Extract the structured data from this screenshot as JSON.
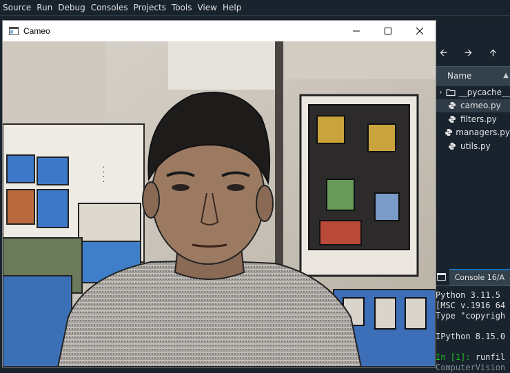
{
  "menubar": {
    "items": [
      "Source",
      "Run",
      "Debug",
      "Consoles",
      "Projects",
      "Tools",
      "View",
      "Help"
    ]
  },
  "cameo": {
    "title": "Cameo",
    "icons": {
      "minimize": "minimize-icon",
      "maximize": "maximize-icon",
      "close": "close-icon"
    }
  },
  "explorer": {
    "nav_icons": [
      "arrow-left-icon",
      "arrow-right-icon",
      "arrow-up-icon"
    ],
    "header": "Name",
    "items": [
      {
        "label": "__pycache__",
        "type": "folder",
        "expandable": true,
        "selected": false
      },
      {
        "label": "cameo.py",
        "type": "python-file",
        "expandable": false,
        "selected": true
      },
      {
        "label": "filters.py",
        "type": "python-file",
        "expandable": false,
        "selected": false
      },
      {
        "label": "managers.py",
        "type": "python-file",
        "expandable": false,
        "selected": false
      },
      {
        "label": "utils.py",
        "type": "python-file",
        "expandable": false,
        "selected": false
      }
    ]
  },
  "console": {
    "tab_label": "Console 16/A",
    "lines": {
      "l1": "Python 3.11.5",
      "l2": "[MSC v.1916 64",
      "l3": "Type \"copyrigh",
      "l4": "IPython 8.15.0",
      "prompt": "In [1]:",
      "cmd": " runfil",
      "l6": "ComputerVision"
    }
  },
  "colors": {
    "ide_background": "#19232d",
    "header_background": "#32414b",
    "accent": "#1a72bb",
    "prompt_green": "#1fbd1f"
  }
}
